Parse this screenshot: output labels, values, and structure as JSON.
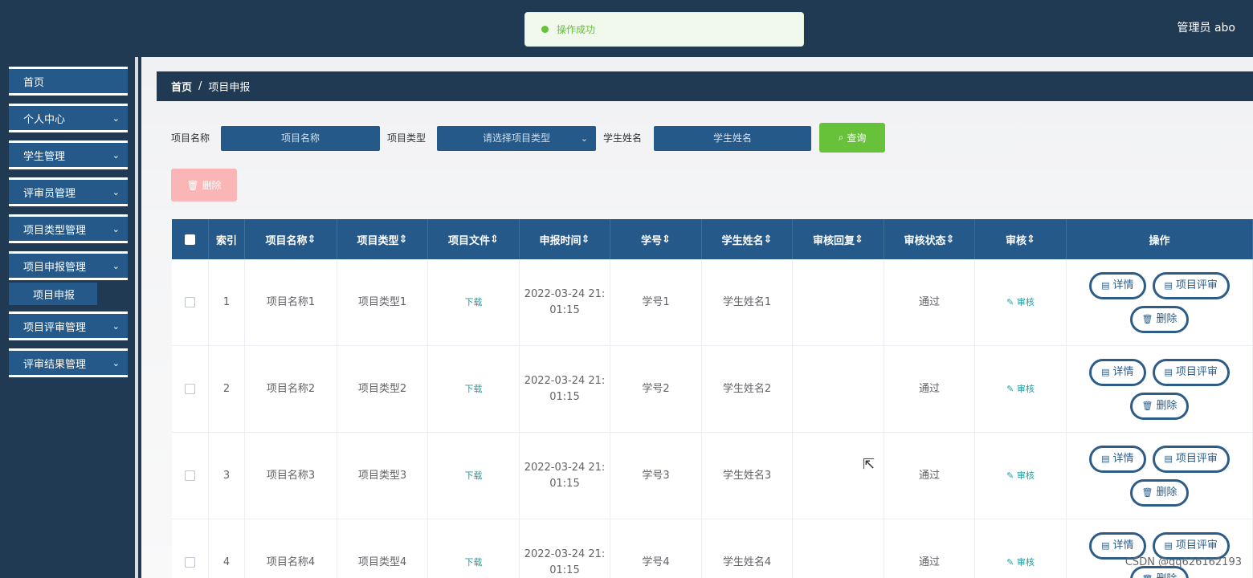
{
  "toast": {
    "text": "操作成功"
  },
  "user": {
    "label": "管理员 abo"
  },
  "sidebar": {
    "items": [
      {
        "label": "首页"
      },
      {
        "label": "个人中心"
      },
      {
        "label": "学生管理"
      },
      {
        "label": "评审员管理"
      },
      {
        "label": "项目类型管理"
      },
      {
        "label": "项目申报管理"
      },
      {
        "label": "项目评审管理"
      },
      {
        "label": "评审结果管理"
      }
    ],
    "sub_item": "项目申报"
  },
  "breadcrumb": {
    "home": "首页",
    "sep": "/",
    "current": "项目申报"
  },
  "search": {
    "name_label": "项目名称",
    "name_placeholder": "项目名称",
    "type_label": "项目类型",
    "type_placeholder": "请选择项目类型",
    "student_label": "学生姓名",
    "student_placeholder": "学生姓名",
    "query_button": "查询"
  },
  "delete_button": "删除",
  "table": {
    "columns": [
      "索引",
      "项目名称",
      "项目类型",
      "项目文件",
      "申报时间",
      "学号",
      "学生姓名",
      "审核回复",
      "审核状态",
      "审核",
      "操作"
    ],
    "rows": [
      {
        "index": "1",
        "name": "项目名称1",
        "type": "项目类型1",
        "file": "下载",
        "time": "2022-03-24 21:01:15",
        "time_a": "2022-03-24 21:",
        "time_b": "01:15",
        "sno": "学号1",
        "student": "学生姓名1",
        "reply": "",
        "status": "通过",
        "audit": "审核"
      },
      {
        "index": "2",
        "name": "项目名称2",
        "type": "项目类型2",
        "file": "下载",
        "time_a": "2022-03-24 21:",
        "time_b": "01:15",
        "sno": "学号2",
        "student": "学生姓名2",
        "reply": "",
        "status": "通过",
        "audit": "审核"
      },
      {
        "index": "3",
        "name": "项目名称3",
        "type": "项目类型3",
        "file": "下载",
        "time_a": "2022-03-24 21:",
        "time_b": "01:15",
        "sno": "学号3",
        "student": "学生姓名3",
        "reply": "",
        "status": "通过",
        "audit": "审核"
      },
      {
        "index": "4",
        "name": "项目名称4",
        "type": "项目类型4",
        "file": "下载",
        "time_a": "2022-03-24 21:",
        "time_b": "01:15",
        "sno": "学号4",
        "student": "学生姓名4",
        "reply": "",
        "status": "通过",
        "audit": "审核"
      }
    ],
    "ops": {
      "detail": "详情",
      "review": "项目评审",
      "delete": "删除"
    }
  },
  "watermark": "CSDN @qq626162193",
  "colors": {
    "nav": "#1f3a52",
    "primary": "#24598a",
    "success": "#67c23a",
    "danger_light": "#fab6b6"
  }
}
